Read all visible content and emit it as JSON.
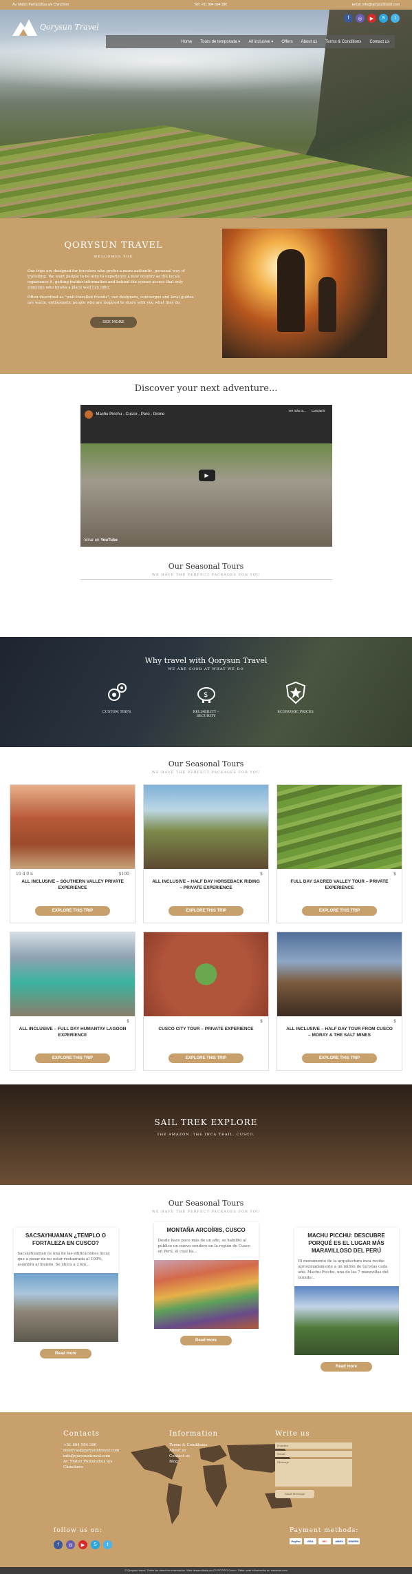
{
  "topbar": {
    "address": "Av. Mateo Pumacahua a/s Chinchero",
    "phone": "Telf: +51 994 584 396",
    "email": "Email: info@qorysuntravel.com"
  },
  "brand": {
    "name": "Qorysun Travel"
  },
  "social": [
    "facebook-icon",
    "instagram-icon",
    "youtube-icon",
    "skype-icon",
    "twitter-icon"
  ],
  "nav": {
    "items": [
      "Home",
      "Tours de temporada",
      "All inclusive",
      "Offers",
      "About us",
      "Terms & Conditions",
      "Contact us"
    ]
  },
  "welcome": {
    "title": "QORYSUN TRAVEL",
    "subtitle": "WELCOMES YOU",
    "p1": "Our trips are designed for travelers who prefer a more authentic, personal way of travelling. We want people to be able to experience a new country as the locals experience it, getting insider information and behind the scenes access that only someone who knows a place well can offer.",
    "p2": "Often described as \"well-travelled friends\", our designers, concierges and local guides are warm, enthusiastic people who are inspired to share with you what they do.",
    "button": "SEE MORE"
  },
  "discover": {
    "title": "Discover your next adventure...",
    "video": {
      "title": "Machu Picchu - Cusco - Perú - Drone",
      "later": "Ver más ta...",
      "share": "Compartir",
      "watch_on": "Mirar en",
      "platform": "YouTube"
    },
    "section_title": "Our Seasonal Tours",
    "tagline": "WE HAVE THE PERFECT PACKAGES FOR YOU"
  },
  "why": {
    "title": "Why travel with Qorysun Travel",
    "subtitle": "WE ARE GOOD AT WHAT WE DO",
    "features": [
      {
        "label": "CUSTOM TRIPS",
        "icon": "gears-icon"
      },
      {
        "label": "RELIABILITY – SECURITY",
        "icon": "piggy-bank-icon"
      },
      {
        "label": "ECONOMIC PRICES",
        "icon": "shield-star-icon"
      }
    ]
  },
  "tours": {
    "title": "Our Seasonal Tours",
    "tagline": "WE HAVE THE PERFECT PACKAGES FOR YOU",
    "cta": "EXPLORE THIS TRIP",
    "items": [
      {
        "name": "ALL INCLUSIVE – SOUTHERN VALLEY PRIVATE EXPERIENCE",
        "duration": "10 d 9 n",
        "price": "$100"
      },
      {
        "name": "ALL INCLUSIVE – HALF DAY HORSEBACK RIDING – PRIVATE EXPERIENCE",
        "duration": "",
        "price": "$"
      },
      {
        "name": "FULL DAY SACRED VALLEY TOUR – PRIVATE EXPERIENCE",
        "duration": "",
        "price": "$"
      },
      {
        "name": "ALL INCLUSIVE – FULL DAY HUMANTAY LAGOON EXPERIENCE",
        "duration": "",
        "price": "$"
      },
      {
        "name": "CUSCO CITY TOUR – PRIVATE EXPERIENCE",
        "duration": "",
        "price": "$"
      },
      {
        "name": "ALL INCLUSIVE – HALF DAY TOUR FROM CUSCO – MORAY & THE SALT MINES",
        "duration": "",
        "price": "$"
      }
    ]
  },
  "banner": {
    "title": "SAIL TREK EXPLORE",
    "subtitle": "THE AMAZON. THE INCA TRAIL. CUSCO."
  },
  "blog": {
    "title": "Our Seasonal Tours",
    "tagline": "WE HAVE THE PERFECT PACKAGES FOR YOU",
    "button": "Read more",
    "posts": [
      {
        "title": "SACSAYHUAMAN ¿TEMPLO O FORTALEZA EN CUSCO?",
        "excerpt": "Sacsayhuaman es una de las edificaciones incas que a pesar de no estar restaurada al 100%, asombra al mundo. Se ubica a 2 km..."
      },
      {
        "title": "MONTAÑA ARCOÍRIS, CUSCO",
        "excerpt": "Desde hace poco más de un año, se habilitó al público un nuevo sendero en la región de Cusco en Perú, el cual ha..."
      },
      {
        "title": "MACHU PICCHU: DESCUBRE PORQUÉ ES EL LUGAR MÁS MARAVILLOSO DEL PERÚ",
        "excerpt": "El monumento de la arquitectura inca recibe aproximadamente a un millón de turistas cada año. Machu Picchu, una de las 7 maravillas del mundo..."
      }
    ]
  },
  "footer": {
    "contacts": {
      "title": "Contacts",
      "lines": [
        "+51 994 584 396",
        "reservas@qorysuntravel.com",
        "info@qorysuntravel.com",
        "Av. Mateo Pumacahua a/s",
        "Chinchero"
      ]
    },
    "information": {
      "title": "Information",
      "lines": [
        "Terms & Conditions",
        "About us",
        "Contact us",
        "Blog"
      ]
    },
    "write": {
      "title": "Write us",
      "name_placeholder": "Nombre",
      "email_placeholder": "Email",
      "message_placeholder": "Mensaje",
      "send": "Send Message"
    },
    "follow": "follow us on:",
    "payment": "Payment methods:",
    "payment_methods": [
      "PayPal",
      "VISA",
      "MC",
      "AMEX",
      "DINERS"
    ],
    "copyright": "© Qorysun travel. Todos los derechos reservados. Web desarrollada por CUSCOGO Cusco. Obtén más información en nosotros.com"
  }
}
